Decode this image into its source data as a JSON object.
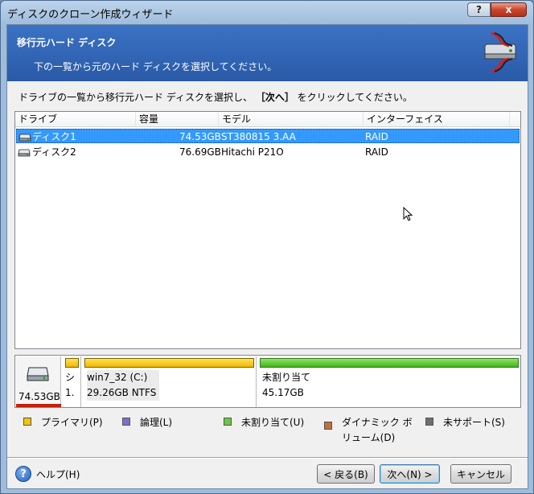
{
  "window": {
    "title": "ディスクのクローン作成ウィザード",
    "help_glyph": "?",
    "close_glyph": "x"
  },
  "header": {
    "title": "移行元ハード ディスク",
    "subtitle": "下の一覧から元のハード ディスクを選択してください。",
    "icon": "disk-clone-icon"
  },
  "instruction": {
    "before": "ドライブの一覧から移行元ハード ディスクを選択し、",
    "bold": "［次へ］",
    "after": "をクリックしてください。"
  },
  "table": {
    "columns": [
      "ドライブ",
      "容量",
      "モデル",
      "インターフェイス"
    ],
    "rows": [
      {
        "drive": "ディスク1",
        "capacity": "74.53GB",
        "model": "ST380815 3.AA",
        "interface": "RAID",
        "selected": true
      },
      {
        "drive": "ディスク2",
        "capacity": "76.69GB",
        "model": "Hitachi P21O",
        "interface": "RAID",
        "selected": false
      }
    ]
  },
  "disk_map": {
    "disk_size": "74.53GB",
    "small_partition": {
      "line1": "シ",
      "line2": "1."
    },
    "partition1": {
      "line1": "win7_32 (C:)",
      "line2": "29.26GB  NTFS"
    },
    "partition2": {
      "line1": "未割り当て",
      "line2": "45.17GB"
    }
  },
  "legend": {
    "primary": "プライマリ(P)",
    "logical": "論理(L)",
    "unallocated": "未割り当て(U)",
    "dynamic_line1": "ダイナミック ボ",
    "dynamic_line2": "リューム(D)",
    "unsupported": "未サポート(S)"
  },
  "footer": {
    "help": "ヘルプ(H)",
    "help_glyph": "?",
    "back": "< 戻る(B)",
    "next": "次へ(N) >",
    "cancel": "キャンセル"
  },
  "colors": {
    "primary": "#f1c40f",
    "logical": "#7b6fd0",
    "unallocated": "#6cc644",
    "dynamic": "#c0703a",
    "unsupported": "#6e6e6e",
    "selection": "#3399ff",
    "header_bg": "#2f63b4"
  }
}
